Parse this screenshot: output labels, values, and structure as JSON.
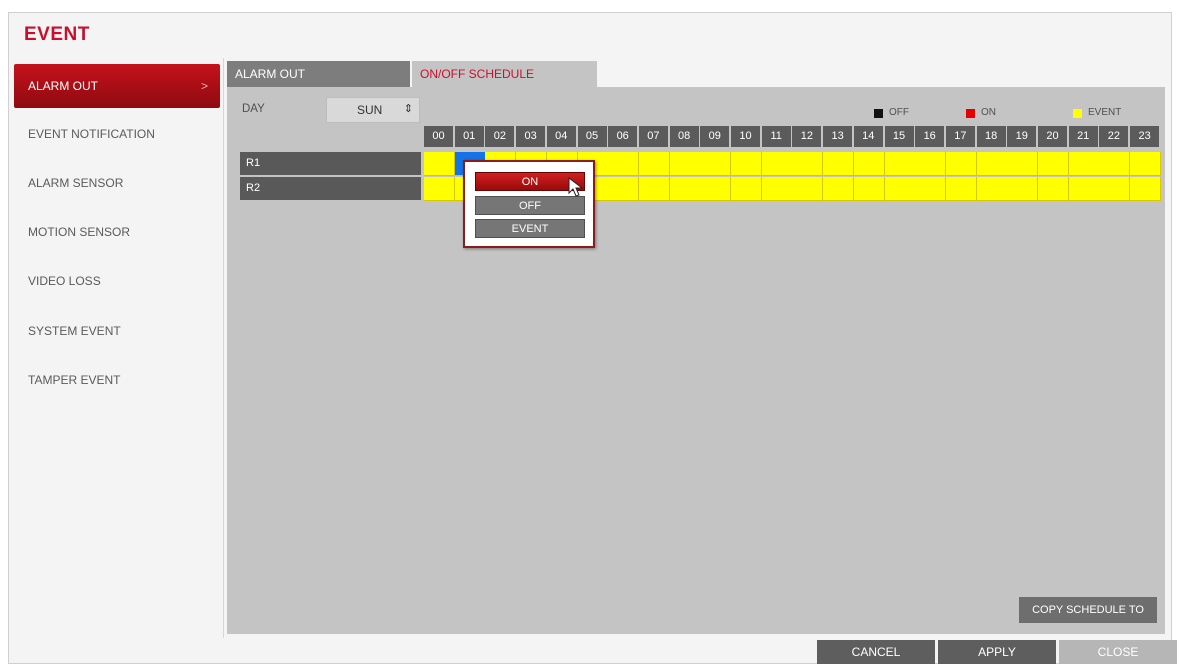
{
  "title": "EVENT",
  "sidebar": {
    "items": [
      {
        "label": "ALARM OUT",
        "active": true
      },
      {
        "label": "EVENT NOTIFICATION"
      },
      {
        "label": "ALARM SENSOR"
      },
      {
        "label": "MOTION SENSOR"
      },
      {
        "label": "VIDEO LOSS"
      },
      {
        "label": "SYSTEM EVENT"
      },
      {
        "label": "TAMPER EVENT"
      }
    ],
    "chevron": ">"
  },
  "tabs": [
    {
      "label": "ALARM OUT"
    },
    {
      "label": "ON/OFF SCHEDULE",
      "active": true
    }
  ],
  "day": {
    "label": "DAY",
    "value": "SUN",
    "arrow": "⇕"
  },
  "legend": [
    {
      "label": "OFF",
      "color": "#111111"
    },
    {
      "label": "ON",
      "color": "#e60000"
    },
    {
      "label": "EVENT",
      "color": "#ffff00"
    }
  ],
  "hours": [
    "00",
    "01",
    "02",
    "03",
    "04",
    "05",
    "06",
    "07",
    "08",
    "09",
    "10",
    "11",
    "12",
    "13",
    "14",
    "15",
    "16",
    "17",
    "18",
    "19",
    "20",
    "21",
    "22",
    "23"
  ],
  "rows": [
    {
      "label": "R1",
      "cells": [
        "EVENT",
        "SELECTED",
        "EVENT",
        "EVENT",
        "EVENT",
        "EVENT",
        "EVENT",
        "EVENT",
        "EVENT",
        "EVENT",
        "EVENT",
        "EVENT",
        "EVENT",
        "EVENT",
        "EVENT",
        "EVENT",
        "EVENT",
        "EVENT",
        "EVENT",
        "EVENT",
        "EVENT",
        "EVENT",
        "EVENT",
        "EVENT"
      ]
    },
    {
      "label": "R2",
      "cells": [
        "EVENT",
        "EVENT",
        "EVENT",
        "EVENT",
        "EVENT",
        "EVENT",
        "EVENT",
        "EVENT",
        "EVENT",
        "EVENT",
        "EVENT",
        "EVENT",
        "EVENT",
        "EVENT",
        "EVENT",
        "EVENT",
        "EVENT",
        "EVENT",
        "EVENT",
        "EVENT",
        "EVENT",
        "EVENT",
        "EVENT",
        "EVENT"
      ]
    }
  ],
  "popup": {
    "options": [
      "ON",
      "OFF",
      "EVENT"
    ]
  },
  "buttons": {
    "copy": "COPY SCHEDULE TO",
    "cancel": "CANCEL",
    "apply": "APPLY",
    "close": "CLOSE"
  }
}
